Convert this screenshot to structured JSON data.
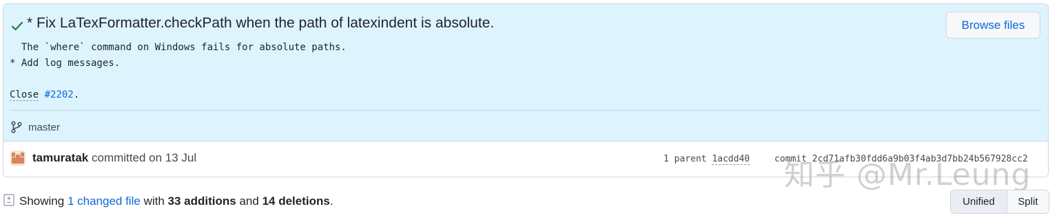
{
  "commit": {
    "title": "* Fix LaTexFormatter.checkPath when the path of latexindent is absolute.",
    "description_lines": [
      "  The `where` command on Windows fails for absolute paths.",
      "* Add log messages.",
      "",
      "Close #2202."
    ],
    "close_prefix": "Close",
    "close_issue": "#2202",
    "close_suffix": ".",
    "branch": "master",
    "author": "tamuratak",
    "committed_text": "committed on 13 Jul",
    "parent_label": "1 parent",
    "parent_sha": "1acdd40",
    "commit_label": "commit",
    "commit_sha": "2cd71afb30fdd6a9b03f4ab3d7bb24b567928cc2",
    "status": "success"
  },
  "buttons": {
    "browse_files": "Browse files"
  },
  "watermark": "知乎 @Mr.Leung",
  "summary": {
    "prefix": "Showing",
    "changed_files": "1 changed file",
    "with": "with",
    "additions": "33 additions",
    "and": "and",
    "deletions": "14 deletions",
    "suffix": "."
  },
  "view_toggle": {
    "unified": "Unified",
    "split": "Split",
    "selected": "Unified"
  },
  "colors": {
    "header_bg": "#ddf4ff",
    "link": "#0969da",
    "check": "#1a7f37"
  },
  "icons": [
    "check-icon",
    "git-branch-icon",
    "avatar",
    "file-diff-icon"
  ]
}
